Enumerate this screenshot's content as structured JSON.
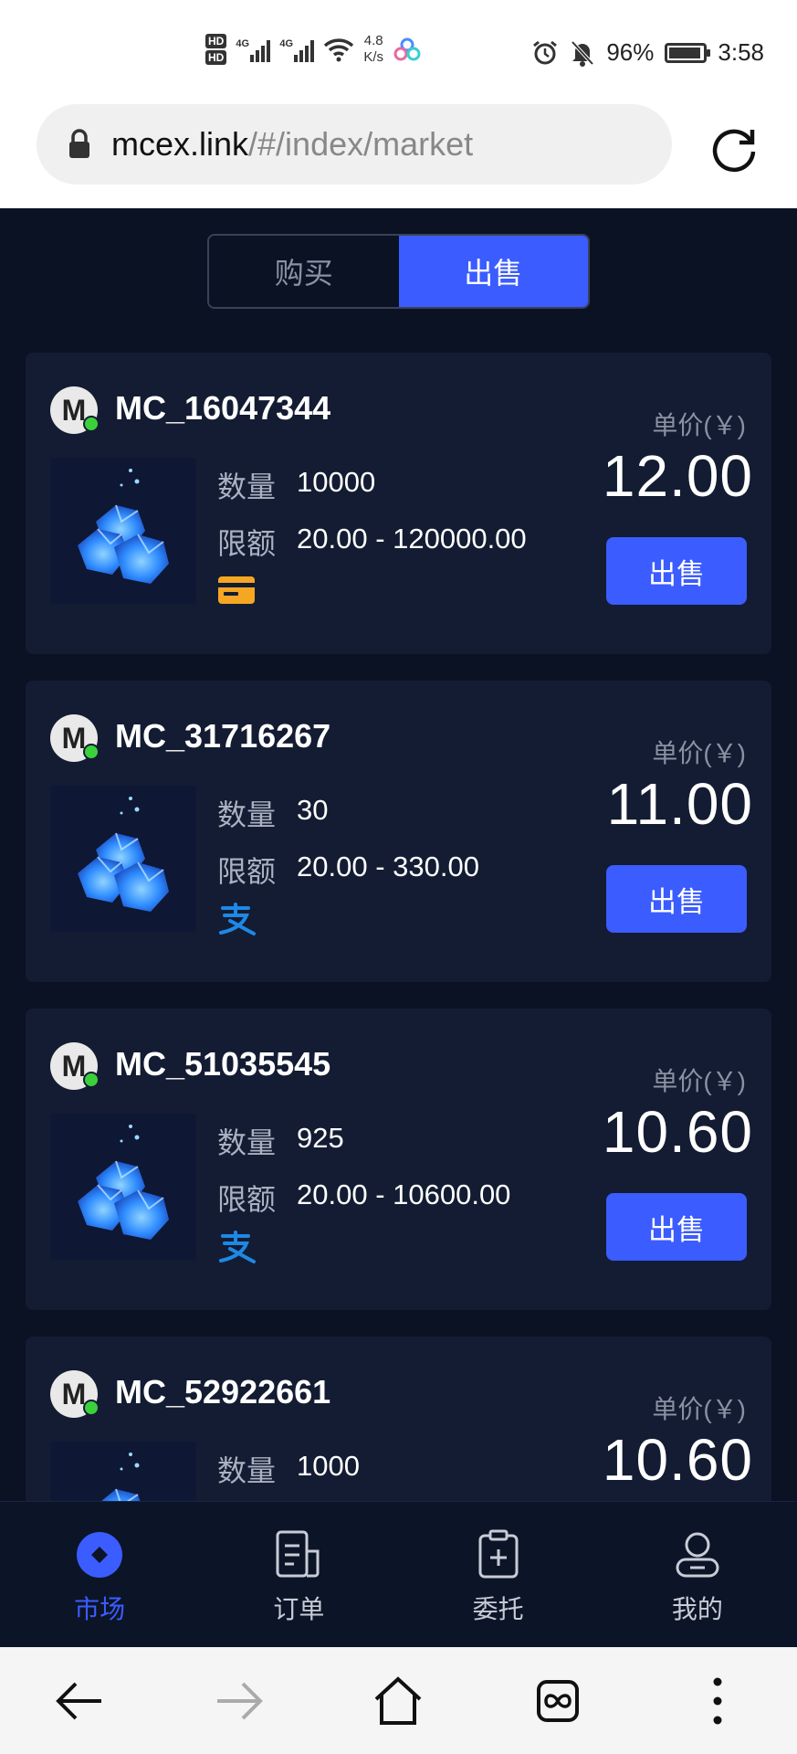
{
  "status_bar": {
    "hd1": "HD",
    "hd2": "HD",
    "net1": "4G",
    "net2": "4G",
    "speed_value": "4.8",
    "speed_unit": "K/s",
    "battery": "96%",
    "time": "3:58"
  },
  "browser": {
    "url_host": "mcex.link",
    "url_path": "/#/index/market"
  },
  "segment": {
    "buy_label": "购买",
    "sell_label": "出售",
    "active": "sell"
  },
  "labels": {
    "unit_price": "单价(￥)",
    "quantity": "数量",
    "limit": "限额",
    "action": "出售"
  },
  "listings": [
    {
      "avatar_letter": "M",
      "username": "MC_16047344",
      "quantity": "10000",
      "limit": "20.00 - 120000.00",
      "payment": "bank-card-icon",
      "price": "12.00"
    },
    {
      "avatar_letter": "M",
      "username": "MC_31716267",
      "quantity": "30",
      "limit": "20.00 - 330.00",
      "payment": "alipay-icon",
      "price": "11.00"
    },
    {
      "avatar_letter": "M",
      "username": "MC_51035545",
      "quantity": "925",
      "limit": "20.00 - 10600.00",
      "payment": "alipay-icon",
      "price": "10.60"
    },
    {
      "avatar_letter": "M",
      "username": "MC_52922661",
      "quantity": "1000",
      "price": "10.60"
    }
  ],
  "tabbar": {
    "items": [
      {
        "label": "市场",
        "icon": "market-icon",
        "active": true
      },
      {
        "label": "订单",
        "icon": "orders-icon",
        "active": false
      },
      {
        "label": "委托",
        "icon": "entrust-icon",
        "active": false
      },
      {
        "label": "我的",
        "icon": "profile-icon",
        "active": false
      }
    ]
  },
  "colors": {
    "background": "#0a1224",
    "card": "#131c32",
    "accent": "#3b5cff",
    "online": "#3ad13a",
    "card_icon": "#f5a623",
    "alipay": "#1e88e5"
  }
}
